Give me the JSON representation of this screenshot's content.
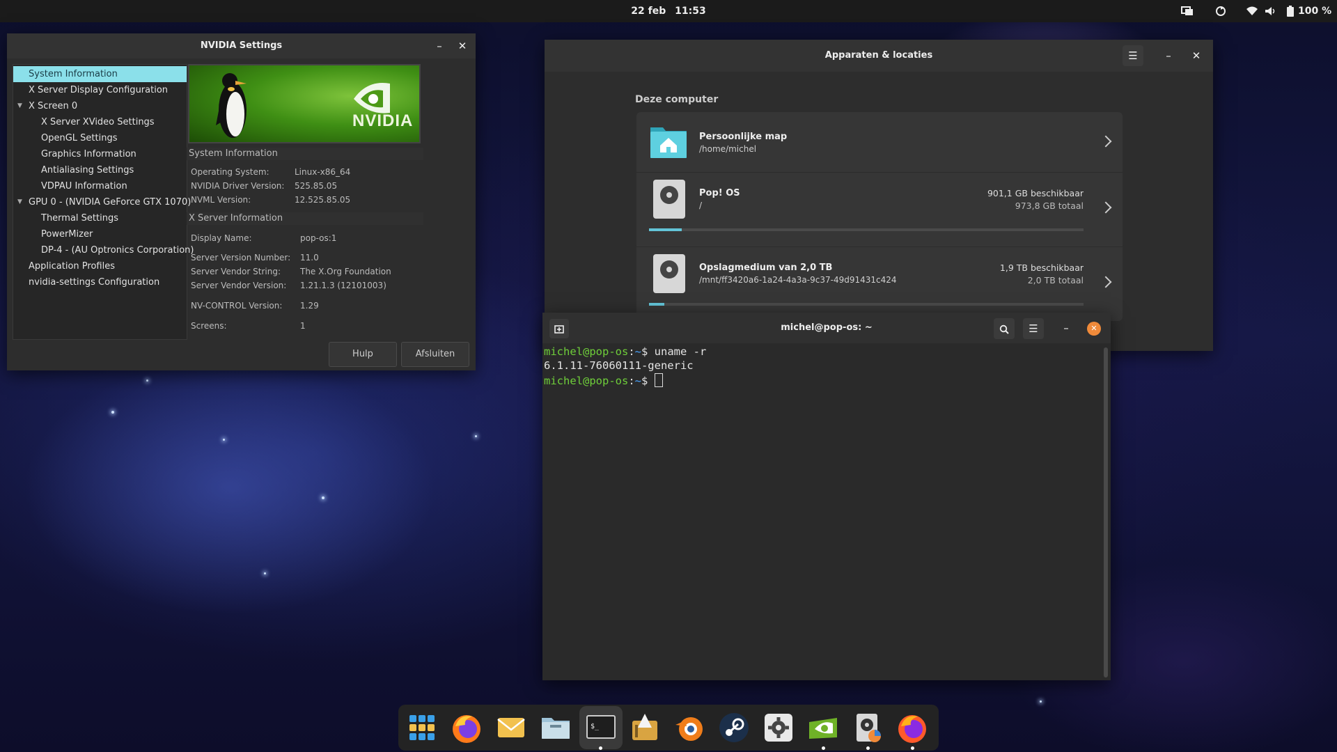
{
  "topbar": {
    "date": "22 feb",
    "time": "11:53",
    "battery": "100 %",
    "icons": [
      "display-icon",
      "sync-icon",
      "wifi-icon",
      "volume-icon",
      "battery-icon"
    ]
  },
  "nvidia": {
    "title": "NVIDIA Settings",
    "tree": [
      "System Information",
      "X Server Display Configuration",
      "X Screen 0",
      "X Server XVideo Settings",
      "OpenGL Settings",
      "Graphics Information",
      "Antialiasing Settings",
      "VDPAU Information",
      "GPU 0 - (NVIDIA GeForce GTX 1070)",
      "Thermal Settings",
      "PowerMizer",
      "DP-4 - (AU Optronics Corporation)",
      "Application Profiles",
      "nvidia-settings Configuration"
    ],
    "banner_logo": "NVIDIA",
    "system_info_header": "System Information",
    "system_info": [
      {
        "key": "Operating System:",
        "value": "Linux-x86_64"
      },
      {
        "key": "NVIDIA Driver Version:",
        "value": "525.85.05"
      },
      {
        "key": "NVML Version:",
        "value": "12.525.85.05"
      }
    ],
    "xserver_header": "X Server Information",
    "xserver_info": [
      {
        "key": "Display Name:",
        "value": "pop-os:1"
      },
      {
        "key": "Server Version Number:",
        "value": "11.0"
      },
      {
        "key": "Server Vendor String:",
        "value": "The X.Org Foundation"
      },
      {
        "key": "Server Vendor Version:",
        "value": "1.21.1.3 (12101003)"
      },
      {
        "key": "NV-CONTROL Version:",
        "value": "1.29"
      },
      {
        "key": "Screens:",
        "value": "1"
      }
    ],
    "help_button": "Hulp",
    "close_button": "Afsluiten"
  },
  "disks": {
    "title": "Apparaten & locaties",
    "section": "Deze computer",
    "items": [
      {
        "name": "Persoonlijke map",
        "path": "/home/michel"
      },
      {
        "name": "Pop! OS",
        "path": "/",
        "available": "901,1 GB beschikbaar",
        "total": "973,8 GB totaal",
        "usage_fraction": 0.075
      },
      {
        "name": "Opslagmedium van 2,0 TB",
        "path": "/mnt/ff3420a6-1a24-4a3a-9c37-49d91431c424",
        "available": "1,9 TB beschikbaar",
        "total": "2,0 TB totaal",
        "usage_fraction": 0.035
      }
    ],
    "accent": "#63c4d8"
  },
  "terminal": {
    "title": "michel@pop-os: ~",
    "lines": [
      {
        "user": "michel@pop-os",
        "path": "~",
        "cmd": "$ uname -r"
      },
      {
        "output": "6.1.11-76060111-generic"
      },
      {
        "user": "michel@pop-os",
        "path": "~",
        "cmd": "$ "
      }
    ]
  },
  "dock": {
    "apps": [
      {
        "name": "app-grid-icon"
      },
      {
        "name": "firefox-icon"
      },
      {
        "name": "mail-icon"
      },
      {
        "name": "files-icon"
      },
      {
        "name": "terminal-icon",
        "running": true,
        "focused": true
      },
      {
        "name": "software-installer-icon"
      },
      {
        "name": "blender-icon"
      },
      {
        "name": "steam-icon"
      },
      {
        "name": "settings-icon"
      },
      {
        "name": "nvidia-settings-icon",
        "running": true
      },
      {
        "name": "disks-icon",
        "running": true
      },
      {
        "name": "firefox-alt-icon",
        "running": true
      }
    ]
  }
}
